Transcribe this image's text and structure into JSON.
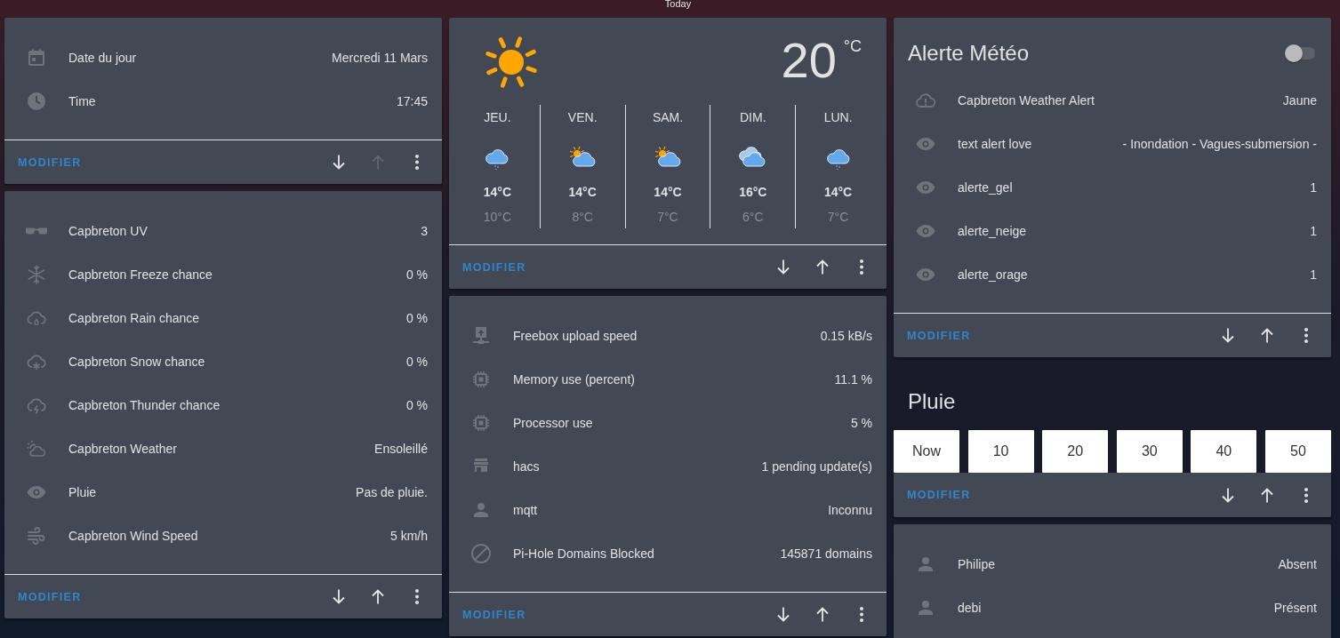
{
  "header": {
    "title": "Today"
  },
  "columns": [
    {
      "cards": [
        {
          "kind": "entities",
          "rows": [
            {
              "kind": "calendar",
              "name": "Date du jour",
              "state": "Mercredi 11 Mars"
            },
            {
              "kind": "clock",
              "name": "Time",
              "state": "17:45"
            }
          ],
          "footer": {
            "action": "MODIFIER",
            "down_disabled": false,
            "up_disabled": true
          }
        },
        {
          "kind": "entities",
          "rows": [
            {
              "kind": "sunglasses",
              "name": "Capbreton UV",
              "state": "3"
            },
            {
              "kind": "snowflake",
              "name": "Capbreton Freeze chance",
              "state": "0 %"
            },
            {
              "kind": "rain",
              "name": "Capbreton Rain chance",
              "state": "0 %"
            },
            {
              "kind": "snow",
              "name": "Capbreton Snow chance",
              "state": "0 %"
            },
            {
              "kind": "thunder",
              "name": "Capbreton Thunder chance",
              "state": "0 %"
            },
            {
              "kind": "weather",
              "name": "Capbreton Weather",
              "state": "Ensoleillé"
            },
            {
              "kind": "eye",
              "name": "Pluie",
              "state": "Pas de pluie."
            },
            {
              "kind": "wind",
              "name": "Capbreton Wind Speed",
              "state": "5 km/h"
            }
          ],
          "footer": {
            "action": "MODIFIER",
            "down_disabled": false,
            "up_disabled": false
          }
        }
      ]
    },
    {
      "cards": [
        {
          "kind": "weather",
          "current": {
            "kind": "sunny",
            "temperature": "20",
            "unit": "°C"
          },
          "forecast": [
            {
              "day": "JEU.",
              "kind": "rainy",
              "high": "14°C",
              "low": "10°C"
            },
            {
              "day": "VEN.",
              "kind": "partlycloudy",
              "high": "14°C",
              "low": "8°C"
            },
            {
              "day": "SAM.",
              "kind": "partlycloudy",
              "high": "14°C",
              "low": "7°C"
            },
            {
              "day": "DIM.",
              "kind": "cloudy",
              "high": "16°C",
              "low": "6°C"
            },
            {
              "day": "LUN.",
              "kind": "rainy",
              "high": "14°C",
              "low": "7°C"
            }
          ],
          "footer": {
            "action": "MODIFIER",
            "down_disabled": false,
            "up_disabled": false
          }
        },
        {
          "kind": "entities",
          "rows": [
            {
              "kind": "upload",
              "name": "Freebox upload speed",
              "state": "0.15 kB/s"
            },
            {
              "kind": "chip",
              "name": "Memory use (percent)",
              "state": "11.1 %"
            },
            {
              "kind": "chip",
              "name": "Processor use",
              "state": "5 %"
            },
            {
              "kind": "store",
              "name": "hacs",
              "state": "1 pending update(s)"
            },
            {
              "kind": "person",
              "name": "mqtt",
              "state": "Inconnu"
            },
            {
              "kind": "block",
              "name": "Pi-Hole Domains Blocked",
              "state": "145871 domains"
            }
          ],
          "footer": {
            "action": "MODIFIER",
            "down_disabled": false,
            "up_disabled": false
          }
        }
      ]
    },
    {
      "cards": [
        {
          "kind": "entities",
          "title": "Alerte Météo",
          "toggle": {
            "on": false
          },
          "rows": [
            {
              "kind": "alert",
              "name": "Capbreton Weather Alert",
              "state": "Jaune"
            },
            {
              "kind": "eye",
              "name": "text alert love",
              "state": "- Inondation - Vagues-submersion -"
            },
            {
              "kind": "eye",
              "name": "alerte_gel",
              "state": "1"
            },
            {
              "kind": "eye",
              "name": "alerte_neige",
              "state": "1"
            },
            {
              "kind": "eye",
              "name": "alerte_orage",
              "state": "1"
            }
          ],
          "footer": {
            "action": "MODIFIER",
            "down_disabled": false,
            "up_disabled": false
          }
        },
        {
          "kind": "buttons",
          "title": "Pluie",
          "buttons": [
            "Now",
            "10",
            "20",
            "30",
            "40",
            "50"
          ],
          "footer": {
            "action": "MODIFIER",
            "down_disabled": false,
            "up_disabled": false
          }
        },
        {
          "kind": "entities",
          "rows": [
            {
              "kind": "person",
              "name": "Philipe",
              "state": "Absent"
            },
            {
              "kind": "person",
              "name": "debi",
              "state": "Présent"
            }
          ]
        }
      ]
    }
  ]
}
